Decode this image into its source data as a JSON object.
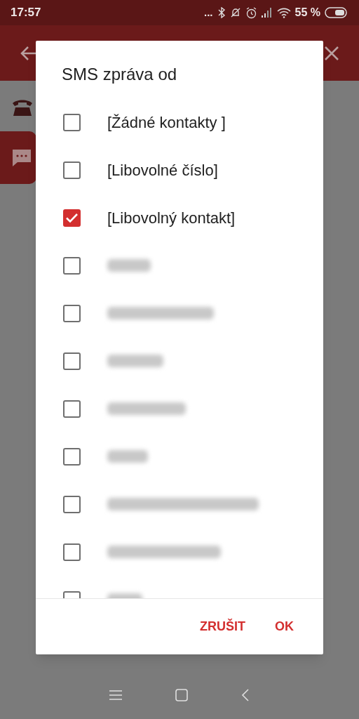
{
  "status_bar": {
    "time": "17:57",
    "dots": "...",
    "battery": "55 %"
  },
  "dialog": {
    "title": "SMS zpráva od",
    "items": [
      {
        "kind": "option",
        "label": "[Žádné kontakty ]",
        "checked": false
      },
      {
        "kind": "option",
        "label": "[Libovolné číslo]",
        "checked": false
      },
      {
        "kind": "option",
        "label": "[Libovolný kontakt]",
        "checked": true
      },
      {
        "kind": "blurred",
        "checked": false
      },
      {
        "kind": "blurred",
        "checked": false
      },
      {
        "kind": "blurred",
        "checked": false
      },
      {
        "kind": "blurred",
        "checked": false
      },
      {
        "kind": "blurred",
        "checked": false
      },
      {
        "kind": "blurred",
        "checked": false
      },
      {
        "kind": "blurred",
        "checked": false
      },
      {
        "kind": "blurred",
        "checked": false
      }
    ],
    "buttons": [
      "ZRUŠIT",
      "OK"
    ]
  }
}
